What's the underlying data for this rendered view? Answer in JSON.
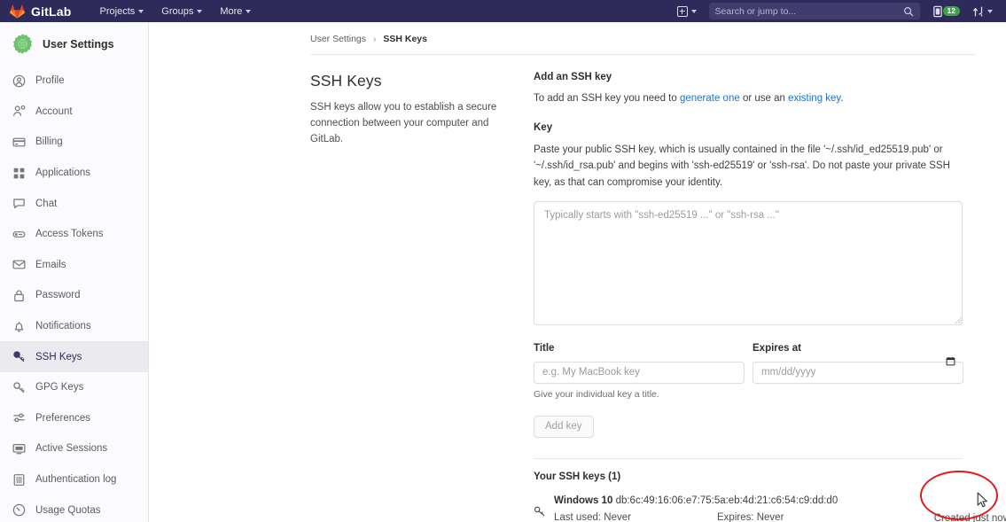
{
  "navbar": {
    "brand": "GitLab",
    "logo_icon": "gitlab-fox-logo",
    "links": [
      {
        "label": "Projects",
        "icon": "chevron-down-icon"
      },
      {
        "label": "Groups",
        "icon": "chevron-down-icon"
      },
      {
        "label": "More",
        "icon": "chevron-down-icon"
      }
    ],
    "create_new": {
      "icon": "plus-square-icon",
      "caret": "chevron-down-icon"
    },
    "search": {
      "placeholder": "Search or jump to...",
      "value": "",
      "icon": "search-icon"
    },
    "issues": {
      "icon": "issues-icon",
      "badge": "12",
      "badge_color": "#43a047"
    },
    "merge_requests": {
      "icon": "merge-request-icon",
      "caret": "chevron-down-icon"
    },
    "background_color": "#2e2b5b"
  },
  "sidebar": {
    "avatar_icon": "cog-avatar-icon",
    "title": "User Settings",
    "active_item": "SSH Keys",
    "items": [
      {
        "label": "Profile",
        "icon": "user-circle-icon"
      },
      {
        "label": "Account",
        "icon": "account-gear-icon"
      },
      {
        "label": "Billing",
        "icon": "credit-card-icon"
      },
      {
        "label": "Applications",
        "icon": "grid-apps-icon"
      },
      {
        "label": "Chat",
        "icon": "chat-bubble-icon"
      },
      {
        "label": "Access Tokens",
        "icon": "token-icon"
      },
      {
        "label": "Emails",
        "icon": "envelope-icon"
      },
      {
        "label": "Password",
        "icon": "lock-icon"
      },
      {
        "label": "Notifications",
        "icon": "bell-icon"
      },
      {
        "label": "SSH Keys",
        "icon": "key-icon"
      },
      {
        "label": "GPG Keys",
        "icon": "key-icon"
      },
      {
        "label": "Preferences",
        "icon": "sliders-icon"
      },
      {
        "label": "Active Sessions",
        "icon": "monitor-icon"
      },
      {
        "label": "Authentication log",
        "icon": "log-book-icon"
      },
      {
        "label": "Usage Quotas",
        "icon": "gauge-icon"
      }
    ]
  },
  "breadcrumb": {
    "parent": "User Settings",
    "separator": "›",
    "current": "SSH Keys"
  },
  "page": {
    "title": "SSH Keys",
    "description": "SSH keys allow you to establish a secure connection between your computer and GitLab."
  },
  "form": {
    "heading": "Add an SSH key",
    "intro_prefix": "To add an SSH key you need to ",
    "intro_link1": "generate one",
    "intro_middle": " or use an ",
    "intro_link2": "existing key",
    "intro_suffix": ".",
    "key_label": "Key",
    "key_help": "Paste your public SSH key, which is usually contained in the file '~/.ssh/id_ed25519.pub' or '~/.ssh/id_rsa.pub' and begins with 'ssh-ed25519' or 'ssh-rsa'. Do not paste your private SSH key, as that can compromise your identity.",
    "key_textarea": {
      "placeholder": "Typically starts with \"ssh-ed25519 ...\" or \"ssh-rsa ...\"",
      "value": ""
    },
    "title_label": "Title",
    "title_input": {
      "placeholder": "e.g. My MacBook key",
      "value": ""
    },
    "title_helper": "Give your individual key a title.",
    "expires_label": "Expires at",
    "expires_input": {
      "placeholder": "mm/dd/yyyy",
      "value": "",
      "icon": "calendar-icon"
    },
    "submit_label": "Add key"
  },
  "keys_list": {
    "heading": "Your SSH keys (1)",
    "rows": [
      {
        "icon": "key-icon",
        "name": "Windows 10",
        "fingerprint": "db:6c:49:16:06:e7:75:5a:eb:4d:21:c6:54:c9:dd:d0",
        "last_used": "Last used: Never",
        "expires": "Expires: Never",
        "created": "Created just now",
        "delete_icon": "trash-icon"
      }
    ]
  },
  "annotation": {
    "shape": "ellipse",
    "color": "#e01b1b",
    "target": "delete-key-button",
    "cursor_icon": "mouse-cursor-icon"
  }
}
